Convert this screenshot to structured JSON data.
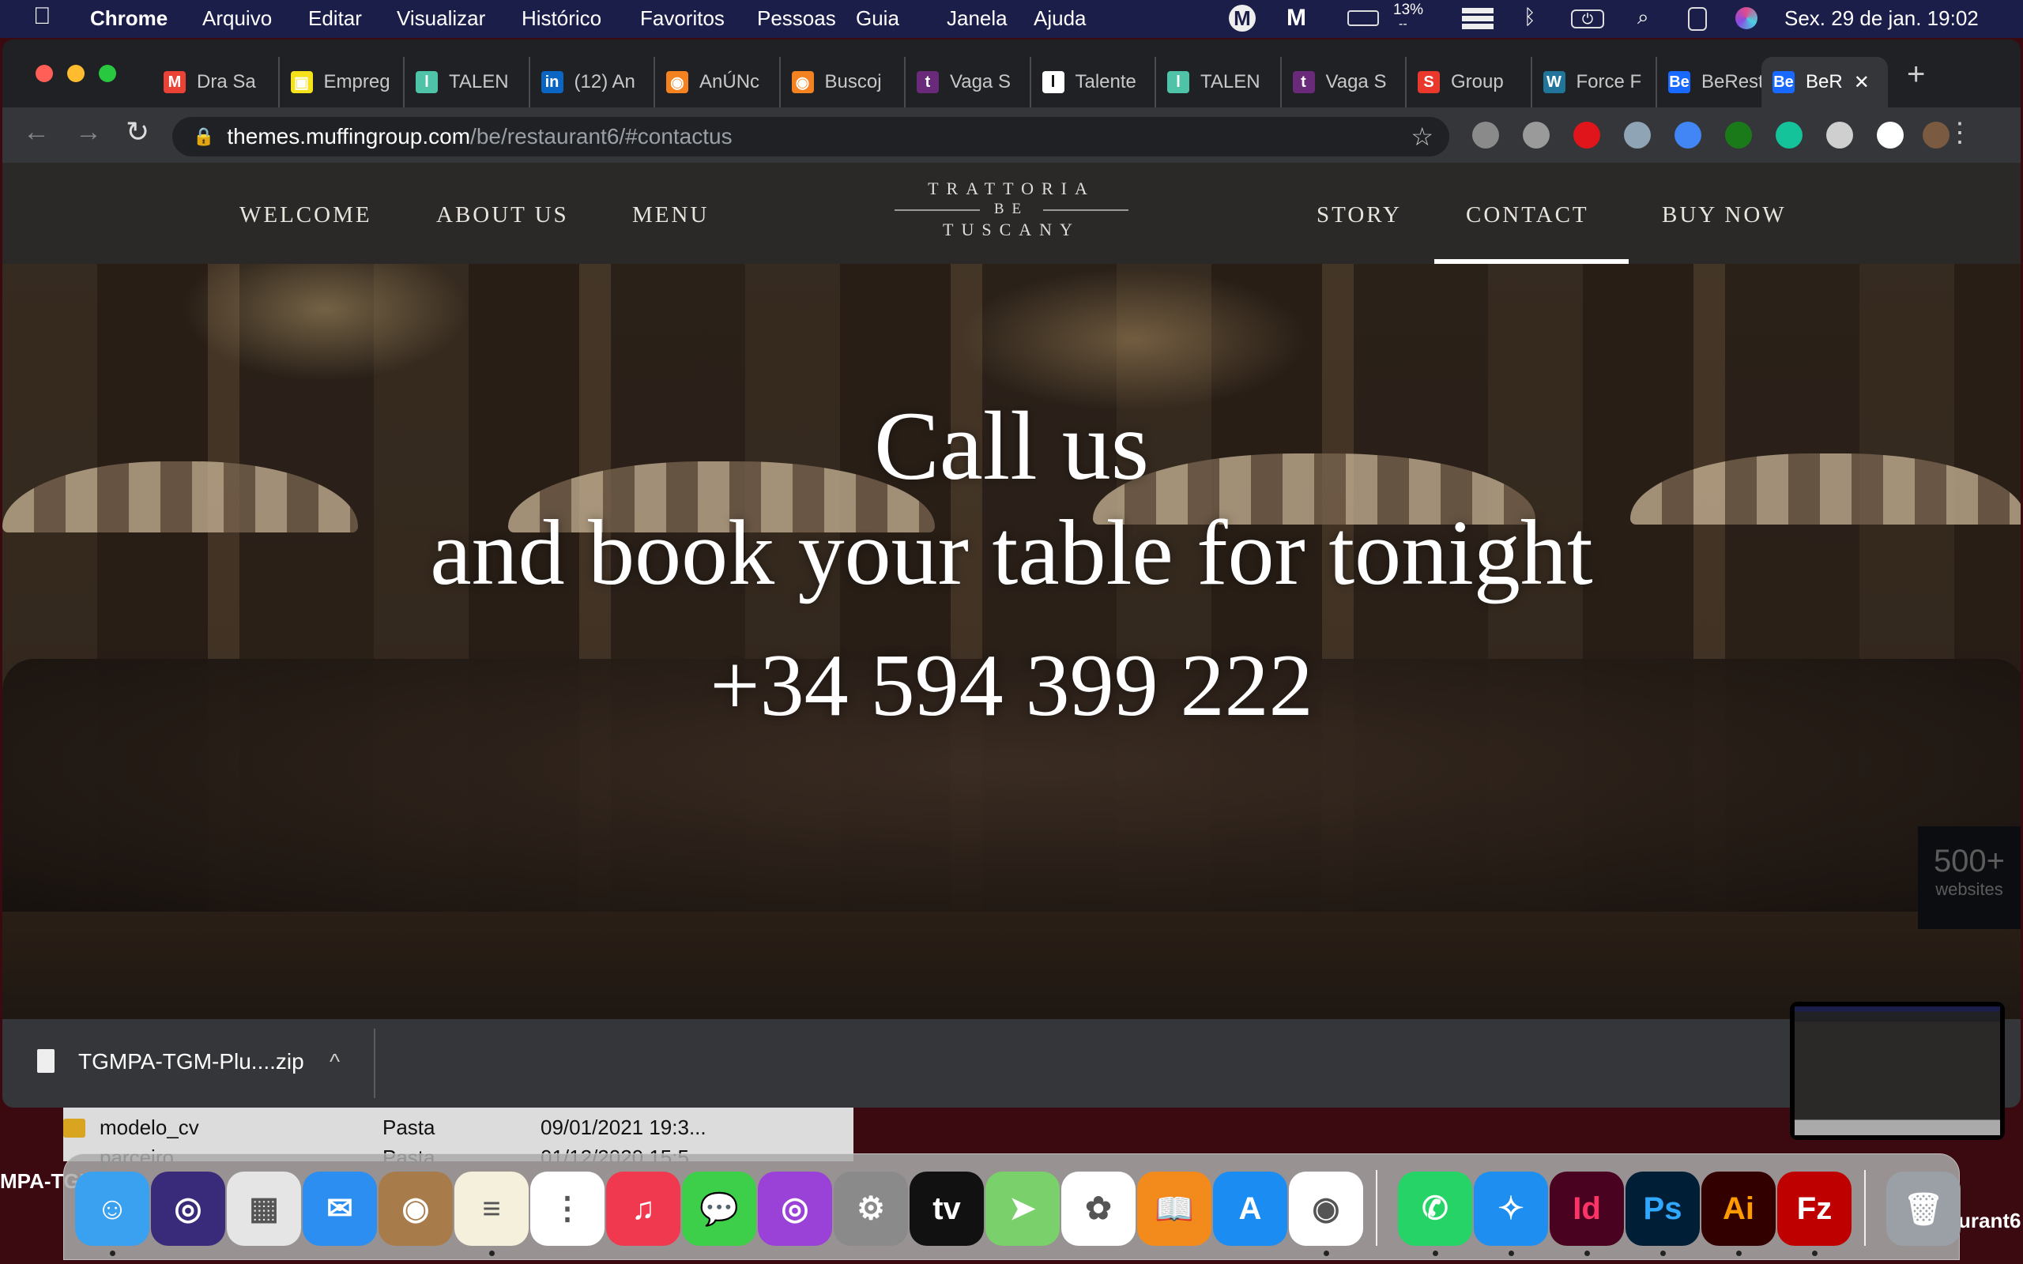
{
  "menubar": {
    "apple": "",
    "items": [
      "Chrome",
      "Arquivo",
      "Editar",
      "Visualizar",
      "Histórico",
      "Favoritos",
      "Pessoas",
      "Guia",
      "Janela",
      "Ajuda"
    ],
    "battery": "13%",
    "battery_sub": "--",
    "datetime": "Sex. 29 de jan.  19:02",
    "status_icons": [
      "mega-icon",
      "malwarebytes-icon",
      "battery-icon",
      "dropzone-icon",
      "bluetooth-icon",
      "power-icon",
      "spotlight-icon",
      "control-center-icon",
      "siri-icon"
    ]
  },
  "browser": {
    "tabs": [
      {
        "label": "Dra Sa",
        "icon": "gmail-icon",
        "color": "#ea4335",
        "glyph": "M"
      },
      {
        "label": "Empreg",
        "icon": "briefcase-icon",
        "color": "#f5e21a",
        "glyph": "▣"
      },
      {
        "label": "TALEN",
        "icon": "talent-icon",
        "color": "#4fc3a8",
        "glyph": "l"
      },
      {
        "label": "(12) An",
        "icon": "linkedin-icon",
        "color": "#0a66c2",
        "glyph": "in"
      },
      {
        "label": "AnÚNc",
        "icon": "orange-ring-icon",
        "color": "#f58220",
        "glyph": "◉"
      },
      {
        "label": "Buscoj",
        "icon": "orange-ring-icon",
        "color": "#f58220",
        "glyph": "◉"
      },
      {
        "label": "Vaga S",
        "icon": "trampos-icon",
        "color": "#6a2a7a",
        "glyph": "t"
      },
      {
        "label": "Talente",
        "icon": "talent-icon",
        "color": "#ffffff",
        "glyph": "l"
      },
      {
        "label": "TALEN",
        "icon": "talent-icon",
        "color": "#4fc3a8",
        "glyph": "l"
      },
      {
        "label": "Vaga S",
        "icon": "trampos-icon",
        "color": "#6a2a7a",
        "glyph": "t"
      },
      {
        "label": "Group",
        "icon": "group-icon",
        "color": "#e8392c",
        "glyph": "S"
      },
      {
        "label": "Force F",
        "icon": "wordpress-icon",
        "color": "#21759b",
        "glyph": "W"
      },
      {
        "label": "BeRest",
        "icon": "behance-icon",
        "color": "#1769ff",
        "glyph": "Be"
      },
      {
        "label": "BeR",
        "icon": "behance-icon",
        "color": "#1769ff",
        "glyph": "Be",
        "active": true
      }
    ],
    "new_tab": "+",
    "close": "✕",
    "url_host": "themes.muffingroup.com",
    "url_path": "/be/restaurant6/#contactus",
    "extensions": [
      "funnel-icon",
      "shield-icon",
      "adblock-icon",
      "download-arrow-icon",
      "google-translate-icon",
      "green-download-icon",
      "grammarly-icon",
      "balls-icon",
      "puzzle-icon",
      "avatar"
    ],
    "extension_colors": [
      "#8a8a8a",
      "#9a9a9a",
      "#e0151b",
      "#8fa4b5",
      "#4285f4",
      "#1a7a1a",
      "#15c39a",
      "#cfcfcf",
      "#ffffff",
      "#7a5a40"
    ]
  },
  "site": {
    "nav_left": [
      "WELCOME",
      "ABOUT US",
      "MENU"
    ],
    "nav_right": [
      "STORY",
      "CONTACT",
      "BUY NOW"
    ],
    "active_nav": "CONTACT",
    "logo": {
      "line1": "TRATTORIA",
      "line2": "BE",
      "line3": "TUSCANY"
    },
    "hero": {
      "line1": "Call us",
      "line2": "and book your table for tonight",
      "phone": "+34 594 399 222"
    },
    "badge": {
      "count": "500+",
      "label": "websites"
    }
  },
  "download": {
    "file": "TGMPA-TGM-Plu....zip",
    "chevron": "^"
  },
  "finder": {
    "rows": [
      {
        "name": "modelo_cv",
        "kind": "Pasta",
        "date": "09/01/2021 19:3..."
      },
      {
        "name": "parceiro",
        "kind": "Pasta",
        "date": "01/12/2020 15:5"
      }
    ]
  },
  "desktop": {
    "left_label": "MPA-TGM",
    "right_label": "urant6"
  },
  "dock": [
    {
      "name": "finder",
      "color": "#3aa0f0",
      "glyph": "☺",
      "running": true
    },
    {
      "name": "siri",
      "color": "#3a2a7a",
      "glyph": "◎"
    },
    {
      "name": "launchpad",
      "color": "#e5e5e5",
      "glyph": "▦"
    },
    {
      "name": "mail",
      "color": "#2b8ef0",
      "glyph": "✉"
    },
    {
      "name": "contacts",
      "color": "#a87c4a",
      "glyph": "◉"
    },
    {
      "name": "notes",
      "color": "#f5f0dc",
      "glyph": "≡",
      "running": true
    },
    {
      "name": "reminders",
      "color": "#ffffff",
      "glyph": "⋮"
    },
    {
      "name": "music",
      "color": "#f0384e",
      "glyph": "♫"
    },
    {
      "name": "messages",
      "color": "#3ecf4a",
      "glyph": "💬"
    },
    {
      "name": "podcasts",
      "color": "#9a42d8",
      "glyph": "◎"
    },
    {
      "name": "system-preferences",
      "color": "#8a8a8a",
      "glyph": "⚙"
    },
    {
      "name": "apple-tv",
      "color": "#111111",
      "glyph": "tv"
    },
    {
      "name": "maps",
      "color": "#7ad06a",
      "glyph": "➤"
    },
    {
      "name": "photos",
      "color": "#ffffff",
      "glyph": "✿"
    },
    {
      "name": "books",
      "color": "#f28a1c",
      "glyph": "📖"
    },
    {
      "name": "app-store",
      "color": "#1b8cf2",
      "glyph": "A"
    },
    {
      "name": "chrome",
      "color": "#ffffff",
      "glyph": "◉",
      "running": true
    },
    {
      "name": "whatsapp",
      "color": "#25d366",
      "glyph": "✆",
      "running": true,
      "sep": true
    },
    {
      "name": "safari",
      "color": "#1e8ef0",
      "glyph": "✧",
      "running": true
    },
    {
      "name": "indesign",
      "color": "#49021f",
      "glyph": "Id",
      "text": "#ff3366",
      "running": true
    },
    {
      "name": "photoshop",
      "color": "#001e36",
      "glyph": "Ps",
      "text": "#31a8ff",
      "running": true
    },
    {
      "name": "illustrator",
      "color": "#330000",
      "glyph": "Ai",
      "text": "#ff9a00",
      "running": true
    },
    {
      "name": "filezilla",
      "color": "#bf0000",
      "glyph": "Fz",
      "running": true
    },
    {
      "name": "trash",
      "color": "#9aa0a6",
      "glyph": "🗑",
      "sep": true
    }
  ]
}
